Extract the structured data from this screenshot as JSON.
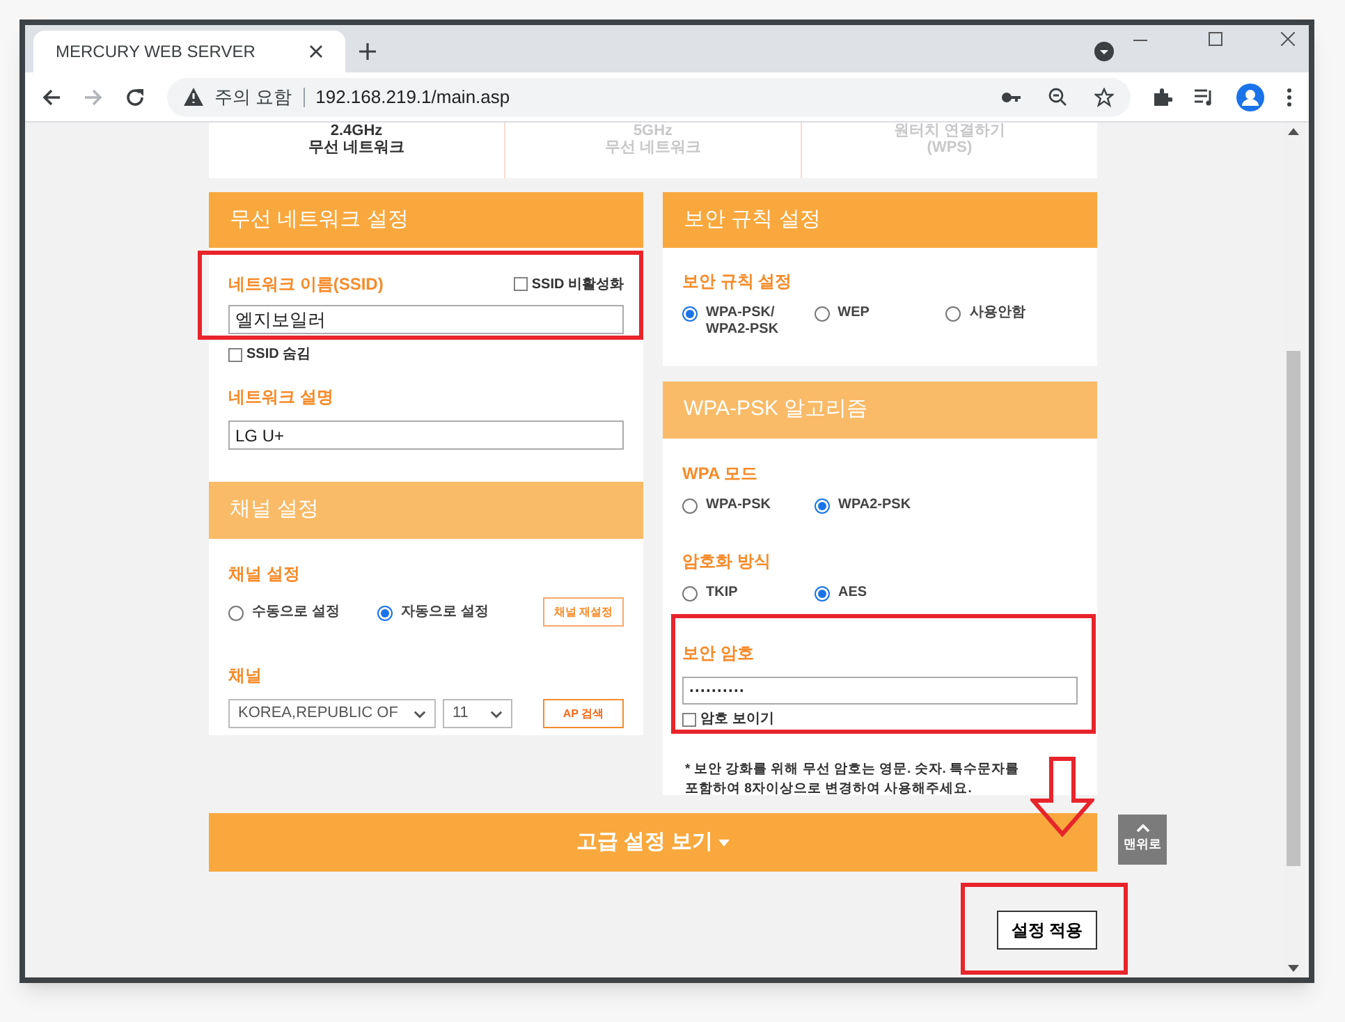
{
  "browser": {
    "tab_title": "MERCURY WEB SERVER",
    "security_label": "주의 요함",
    "url": "192.168.219.1/main.asp"
  },
  "band_tabs": [
    {
      "line1": "2.4GHz",
      "line2": "무선 네트워크",
      "selected": true
    },
    {
      "line1": "5GHz",
      "line2": "무선 네트워크",
      "selected": false
    },
    {
      "line1": "원터치 연결하기",
      "line2": "(WPS)",
      "selected": false
    }
  ],
  "wireless": {
    "title": "무선 네트워크 설정",
    "ssid_label": "네트워크 이름(SSID)",
    "disable_ssid": {
      "label": "SSID 비활성화",
      "checked": false
    },
    "ssid_value": "엘지보일러",
    "hide_ssid": {
      "label": "SSID 숨김",
      "checked": false
    },
    "description_label": "네트워크 설명",
    "description_value": "LG U+"
  },
  "channel": {
    "title": "채널 설정",
    "mode_label": "채널 설정",
    "modes": [
      {
        "label": "수동으로 설정",
        "selected": false
      },
      {
        "label": "자동으로 설정",
        "selected": true
      }
    ],
    "reset_button": "채널 재설정",
    "channel_label": "채널",
    "country": "KOREA,REPUBLIC OF",
    "channel_value": "11",
    "scan_button": "AP 검색"
  },
  "security": {
    "title": "보안 규칙 설정",
    "label": "보안 규칙 설정",
    "options": [
      {
        "label": "WPA-PSK/\nWPA2-PSK",
        "selected": true
      },
      {
        "label": "WEP",
        "selected": false
      },
      {
        "label": "사용안함",
        "selected": false
      }
    ]
  },
  "algorithm": {
    "title": "WPA-PSK 알고리즘",
    "mode_label": "WPA 모드",
    "modes": [
      {
        "label": "WPA-PSK",
        "selected": false
      },
      {
        "label": "WPA2-PSK",
        "selected": true
      }
    ],
    "cipher_label": "암호화 방식",
    "ciphers": [
      {
        "label": "TKIP",
        "selected": false
      },
      {
        "label": "AES",
        "selected": true
      }
    ],
    "password_label": "보안 암호",
    "password_value": "··········",
    "show_password": {
      "label": "암호 보이기",
      "checked": false
    },
    "note": "* 보안 강화를 위해 무선 암호는 영문. 숫자. 특수문자를 포함하여 8자이상으로 변경하여 사용해주세요."
  },
  "advanced_button": "고급 설정 보기",
  "top_button": "맨위로",
  "apply_button": "설정 적용"
}
